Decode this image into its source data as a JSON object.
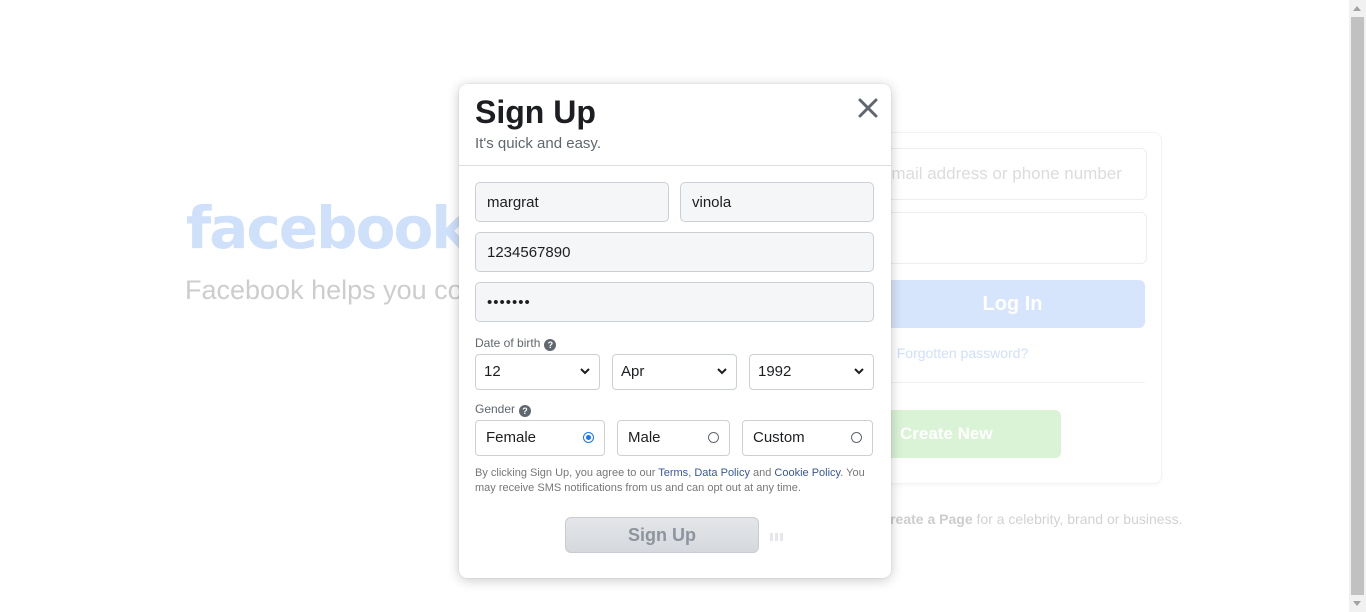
{
  "background": {
    "logo": "facebook",
    "tagline": "Facebook helps you connect and share with the people in your life.",
    "email_placeholder": "Email address or phone number",
    "login_button": "Log In",
    "forgot_link": "Forgotten password?",
    "create_button": "Create New Account",
    "page_prefix": "Create a Page",
    "page_suffix": " for a celebrity, brand or business."
  },
  "modal": {
    "title": "Sign Up",
    "subtitle": "It's quick and easy.",
    "first_name": "margrat",
    "surname": "vinola",
    "mobile": "1234567890",
    "password": "•••••••",
    "dob_label": "Date of birth",
    "dob_day": "12",
    "dob_month": "Apr",
    "dob_year": "1992",
    "gender_label": "Gender",
    "gender_options": [
      "Female",
      "Male",
      "Custom"
    ],
    "gender_selected": "Female",
    "terms_intro": "By clicking Sign Up, you agree to our ",
    "terms_link": "Terms",
    "terms_sep": ", ",
    "data_policy_link": "Data Policy",
    "terms_and": " and ",
    "cookie_link": "Cookie Policy",
    "terms_outro": ". You may receive SMS notifications from us and can opt out at any time.",
    "signup_button": "Sign Up"
  },
  "colors": {
    "accent": "#1877f2",
    "title": "#1c1e21",
    "link": "#385898"
  }
}
